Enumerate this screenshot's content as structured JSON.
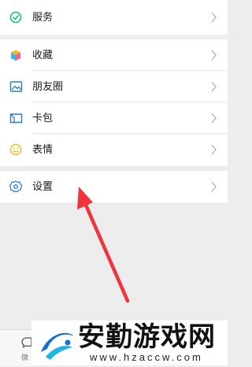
{
  "menu": {
    "services": {
      "label": "服务",
      "icon": "services-icon"
    },
    "favorites": {
      "label": "收藏",
      "icon": "favorites-cube-icon"
    },
    "moments": {
      "label": "朋友圈",
      "icon": "moments-picture-icon"
    },
    "cards": {
      "label": "卡包",
      "icon": "card-wallet-icon"
    },
    "stickers": {
      "label": "表情",
      "icon": "smiley-icon"
    },
    "settings": {
      "label": "设置",
      "icon": "gear-icon"
    }
  },
  "tabbar": {
    "partial_label": "微",
    "icon": "chat-bubble-icon"
  },
  "watermark": {
    "title": "安勤游戏网",
    "url": "www.hzaccw.com"
  },
  "colors": {
    "background": "#ededed",
    "row": "#ffffff",
    "services": "#07c160",
    "moments": "#2a7ad6",
    "cards": "#2a7ad6",
    "stickers": "#f5b921",
    "settings": "#2a7ad6",
    "annotation_arrow": "#f0333c",
    "logo_blue": "#1a6fd1",
    "logo_cyan": "#20b4e6"
  }
}
